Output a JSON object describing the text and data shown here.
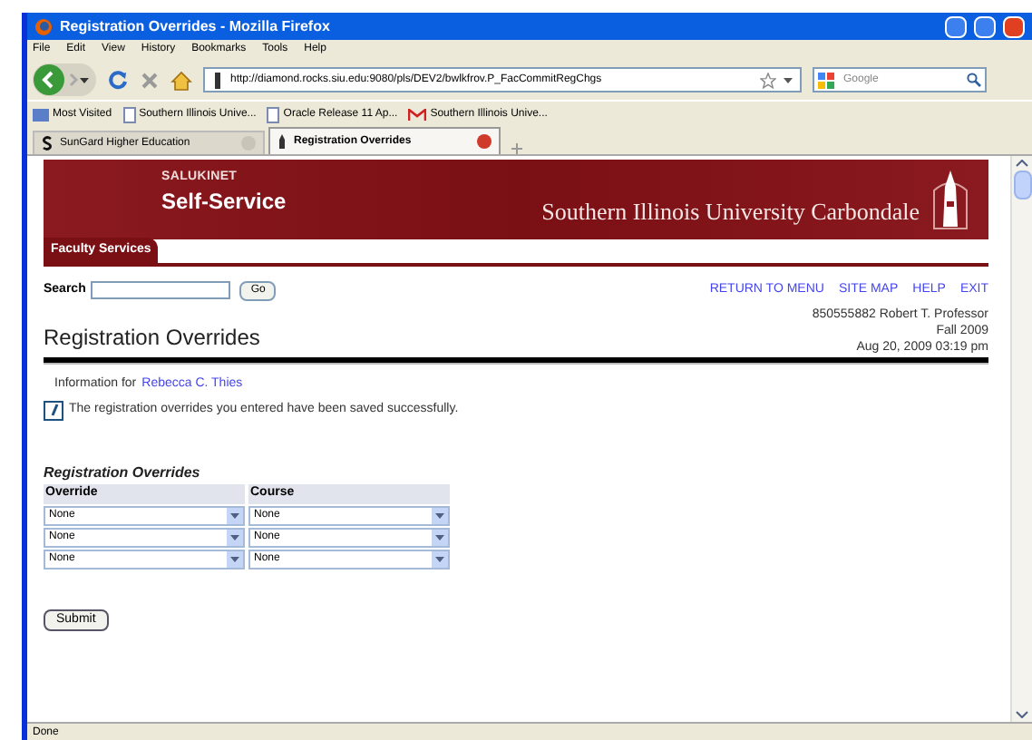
{
  "window": {
    "title": "Registration Overrides - Mozilla Firefox"
  },
  "menu": [
    "File",
    "Edit",
    "View",
    "History",
    "Bookmarks",
    "Tools",
    "Help"
  ],
  "address": {
    "value": "http://diamond.rocks.siu.edu:9080/pls/DEV2/bwlkfrov.P_FacCommitRegChgs"
  },
  "web_search": {
    "placeholder": "Google"
  },
  "bookmarks": [
    {
      "label": "Most Visited",
      "kind": "folder"
    },
    {
      "label": "Southern Illinois Unive...",
      "kind": "page"
    },
    {
      "label": "Oracle Release 11 Ap...",
      "kind": "page"
    },
    {
      "label": "Southern Illinois Unive...",
      "kind": "mail"
    }
  ],
  "tabs": [
    {
      "label": "SunGard Higher Education",
      "selected": false
    },
    {
      "label": "Registration Overrides",
      "selected": true
    }
  ],
  "banner": {
    "brand": "SALUKINET",
    "product": "Self-Service",
    "university": "Southern Illinois University Carbondale"
  },
  "section_tab": "Faculty Services",
  "search": {
    "label": "Search",
    "button": "Go"
  },
  "links": [
    "RETURN TO MENU",
    "SITE MAP",
    "HELP",
    "EXIT"
  ],
  "page_title": "Registration Overrides",
  "user_info": [
    "850555882 Robert T. Professor",
    "Fall 2009",
    "Aug 20, 2009 03:19 pm"
  ],
  "info": {
    "label": "Information for",
    "student": "Rebecca C. Thies"
  },
  "confirmation": {
    "checked": true,
    "message": "The registration overrides you entered have been saved successfully."
  },
  "overrides": {
    "heading": "Registration Overrides",
    "columns": [
      "Override",
      "Course"
    ],
    "rows": [
      [
        "None",
        "None"
      ],
      [
        "None",
        "None"
      ],
      [
        "None",
        "None"
      ]
    ]
  },
  "submit": "Submit",
  "status_bar": "Done"
}
